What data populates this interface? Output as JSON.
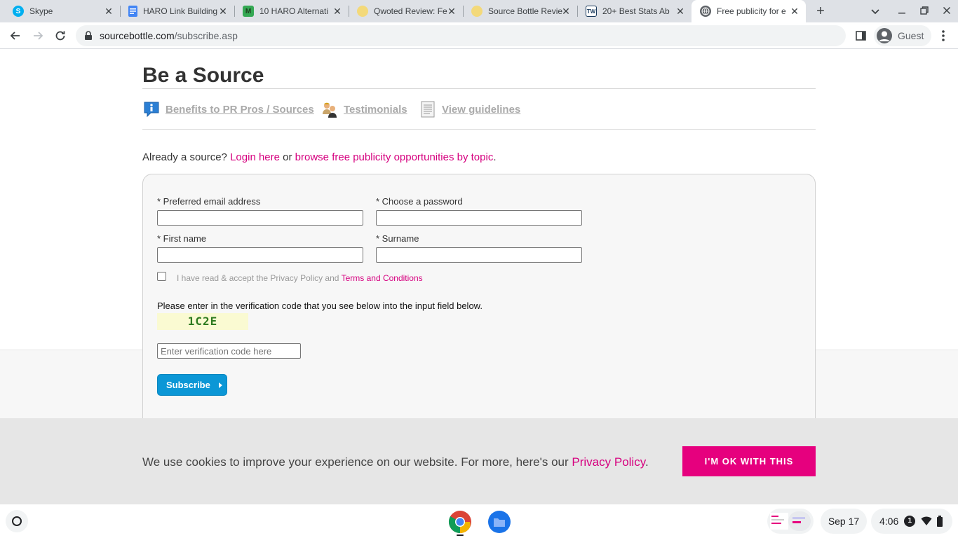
{
  "browser": {
    "tabs": [
      {
        "title": "Skype",
        "favicon": "skype-icon",
        "favicon_color": "#00aff0",
        "favicon_glyph": "S",
        "active": false
      },
      {
        "title": "HARO Link Building",
        "favicon": "google-docs-icon",
        "favicon_color": "#4285f4",
        "favicon_glyph": "",
        "active": false
      },
      {
        "title": "10 HARO Alternati",
        "favicon": "m-icon",
        "favicon_color": "#34a853",
        "favicon_glyph": "M",
        "active": false
      },
      {
        "title": "Qwoted Review: Fe",
        "favicon": "qwoted-icon",
        "favicon_color": "#f3d97a",
        "favicon_glyph": "",
        "active": false
      },
      {
        "title": "Source Bottle Revie",
        "favicon": "sourcebottle-icon",
        "favicon_color": "#f3d97a",
        "favicon_glyph": "",
        "active": false
      },
      {
        "title": "20+ Best Stats Ab",
        "favicon": "tw-icon",
        "favicon_color": "#1a3a5c",
        "favicon_glyph": "TW",
        "active": false
      },
      {
        "title": "Free publicity for e",
        "favicon": "globe-icon",
        "favicon_color": "#5f6368",
        "favicon_glyph": "",
        "active": true
      }
    ],
    "url_host": "sourcebottle.com",
    "url_path": "/subscribe.asp",
    "profile_label": "Guest"
  },
  "page": {
    "title": "Be a Source",
    "links": [
      {
        "label": "Benefits to PR Pros / Sources",
        "icon": "info-icon"
      },
      {
        "label": "Testimonials",
        "icon": "people-icon"
      },
      {
        "label": "View guidelines",
        "icon": "document-icon"
      }
    ],
    "already_prefix": "Already a source?",
    "login_link": "Login here",
    "or_text": "or",
    "browse_link": "browse free publicity opportunities by topic",
    "period": "."
  },
  "form": {
    "email_label": "* Preferred email address",
    "email_value": "",
    "password_label": "* Choose a password",
    "password_value": "",
    "firstname_label": "* First name",
    "firstname_value": "",
    "surname_label": "* Surname",
    "surname_value": "",
    "terms_prefix": "I have read & accept the Privacy Policy and",
    "terms_link": "Terms and Conditions",
    "terms_checked": false,
    "verify_text": "Please enter in the verification code that you see below into the input field below.",
    "captcha_text": "1C2E",
    "verify_placeholder": "Enter verification code here",
    "subscribe_label": "Subscribe"
  },
  "cookie": {
    "message": "We use cookies to improve your experience on our website. For more, here's our",
    "policy_link": "Privacy Policy",
    "period": ".",
    "ok_label": "I'M OK WITH THIS"
  },
  "shelf": {
    "date": "Sep 17",
    "time": "4:06",
    "notification_count": "1"
  },
  "colors": {
    "brand_pink": "#d6007f",
    "button_blue": "#0b97d6",
    "cookie_button": "#e6007e"
  }
}
